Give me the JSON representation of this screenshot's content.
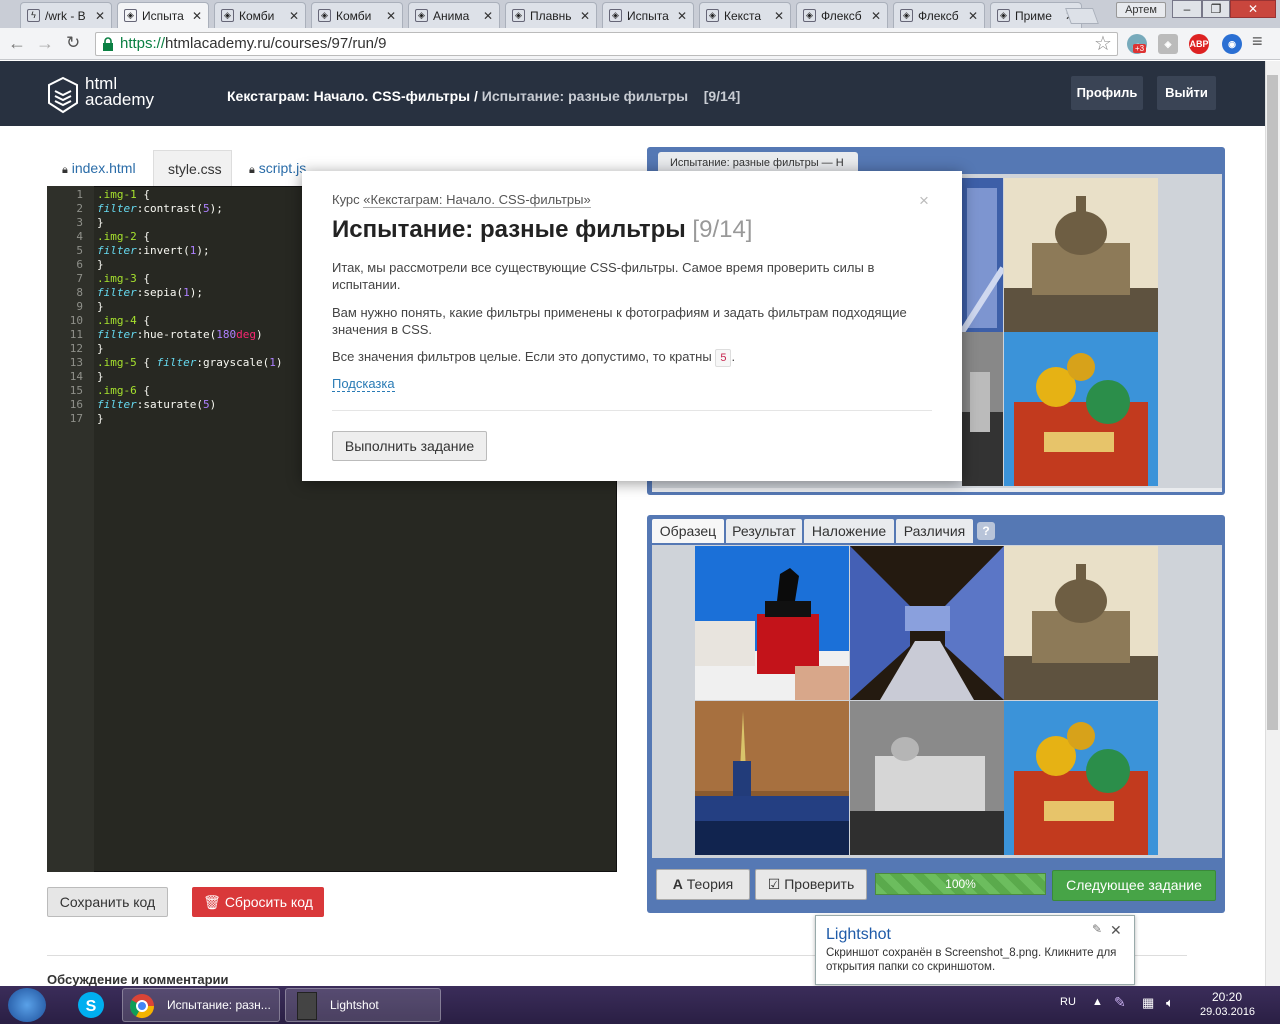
{
  "browser": {
    "tabs": [
      {
        "title": "/wrk - B",
        "active": false
      },
      {
        "title": "Испыта",
        "active": true
      },
      {
        "title": "Комби",
        "active": false
      },
      {
        "title": "Комби",
        "active": false
      },
      {
        "title": "Анима",
        "active": false
      },
      {
        "title": "Плавнь",
        "active": false
      },
      {
        "title": "Испыта",
        "active": false
      },
      {
        "title": "Кекста",
        "active": false
      },
      {
        "title": "Флексб",
        "active": false
      },
      {
        "title": "Флексб",
        "active": false
      },
      {
        "title": "Приме",
        "active": false
      }
    ],
    "user": "Артем",
    "url_secure": "https://",
    "url_rest": "htmlacademy.ru/courses/97/run/9",
    "abp": "ABP",
    "badge_count": "+3"
  },
  "site": {
    "logo_line1": "html",
    "logo_line2": "academy",
    "crumb_course": "Кекстаграм: Начало. CSS-фильтры /",
    "crumb_task": "Испытание: разные фильтры",
    "crumb_count": "[9/14]",
    "profile_btn": "Профиль",
    "logout_btn": "Выйти"
  },
  "editor": {
    "tabs": [
      "index.html",
      "style.css",
      "script.js"
    ],
    "active_tab": "style.css",
    "save_btn": "Сохранить код",
    "reset_btn": "Сбросить код"
  },
  "preview": {
    "tab_title": "Испытание: разные фильтры — H"
  },
  "reference": {
    "tabs": [
      "Образец",
      "Результат",
      "Наложение",
      "Различия"
    ],
    "help": "?"
  },
  "bottom": {
    "theory_btn": "Теория",
    "check_btn": "Проверить",
    "progress_label": "100%",
    "progress_value": 1.0,
    "next_btn": "Следующее задание"
  },
  "modal": {
    "course_prefix": "Курс",
    "course_link": "«Кекстаграм: Начало. CSS-фильтры»",
    "title": "Испытание: разные фильтры",
    "count": "[9/14]",
    "p1": "Итак, мы рассмотрели все существующие CSS-фильтры. Самое время проверить силы в испытании.",
    "p2": "Вам нужно понять, какие фильтры применены к фотографиям и задать фильтрам подходящие значения в CSS.",
    "p3_text": "Все значения фильтров целые. Если это допустимо, то кратны",
    "p3_num": "5",
    "p3_end": ".",
    "hint": "Подсказка",
    "action_btn": "Выполнить задание",
    "close": "×"
  },
  "page": {
    "discussion": "Обсуждение и комментарии"
  },
  "toast": {
    "title": "Lightshot",
    "message": "Скриншот сохранён в Screenshot_8.png. Кликните для открытия папки со скриншотом."
  },
  "taskbar": {
    "task1": "Испытание: разн...",
    "task2": "Lightshot",
    "lang": "RU",
    "time": "20:20",
    "date": "29.03.2016"
  },
  "colors": {
    "header_bg": "#283140",
    "panel_blue": "#5578b4",
    "next_green": "#47a447",
    "reset_red": "#d9383a"
  }
}
